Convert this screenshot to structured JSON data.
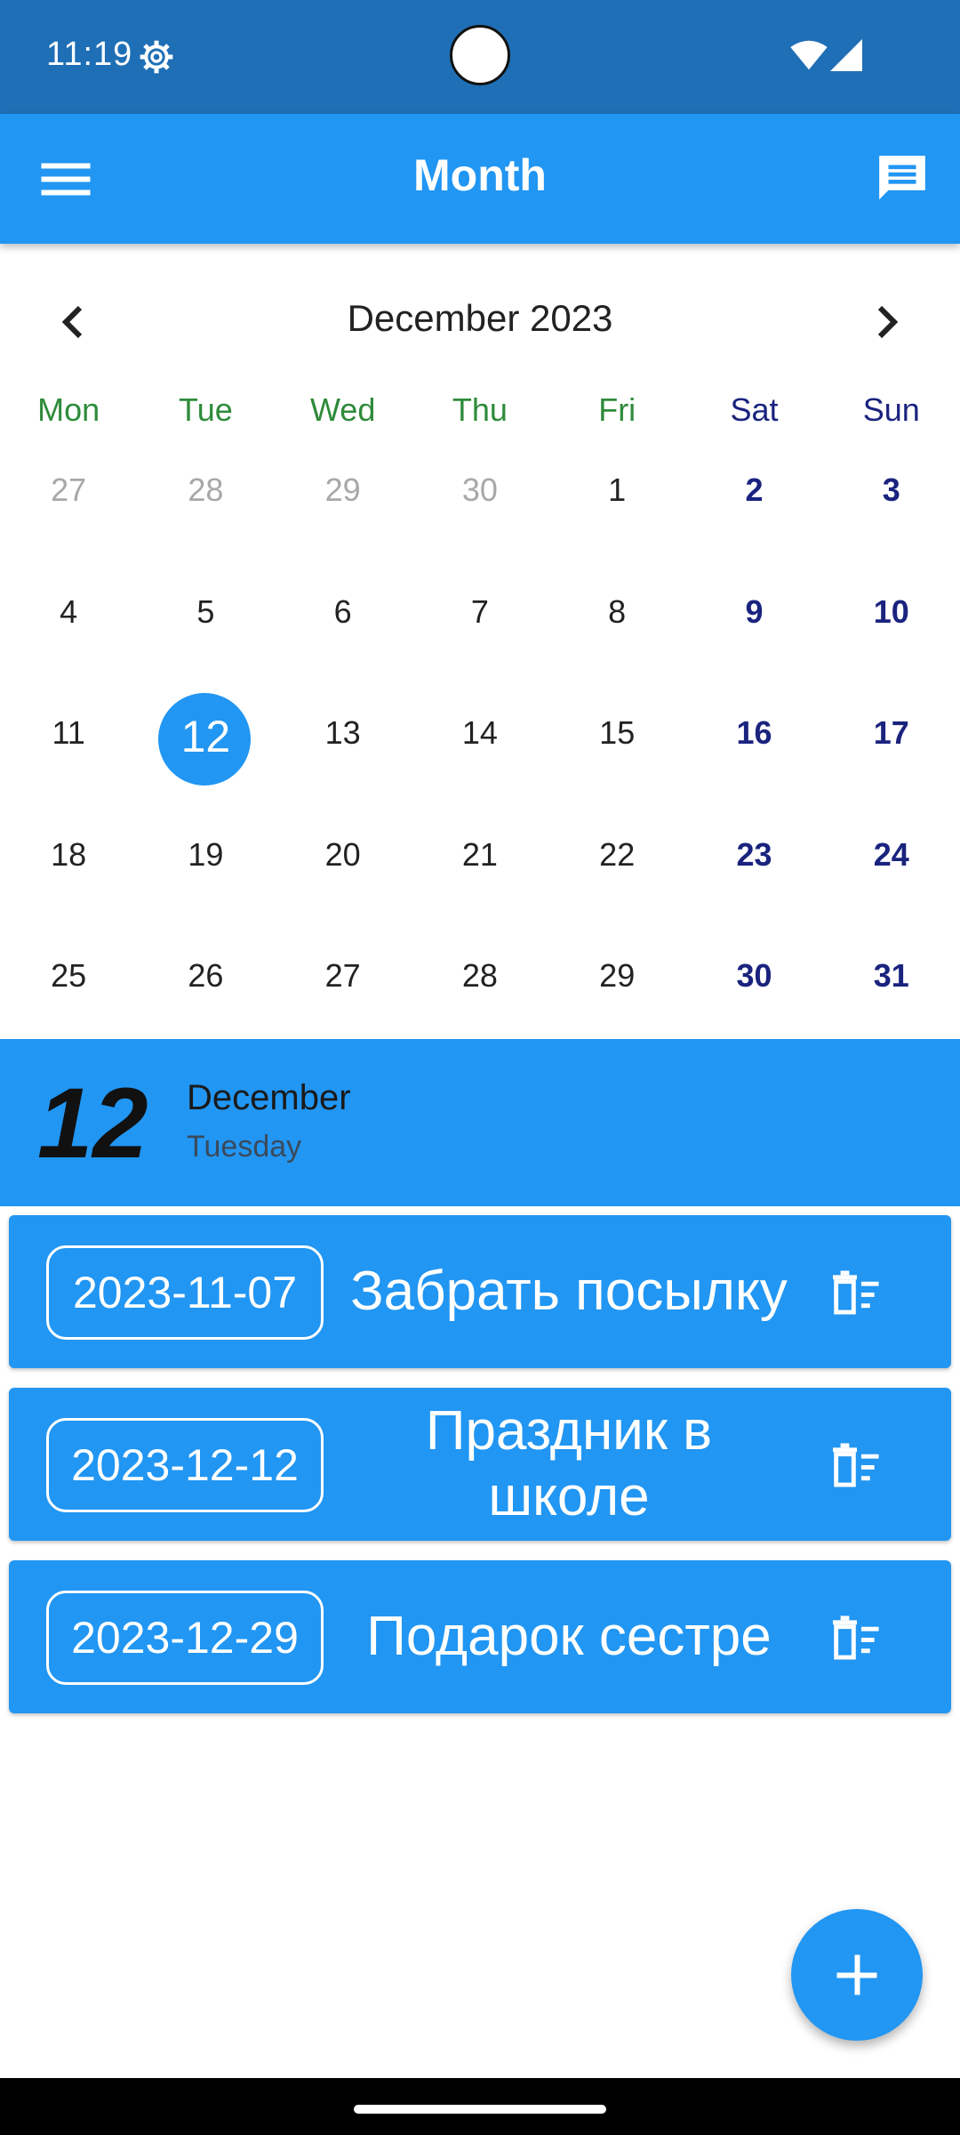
{
  "status_bar": {
    "time": "11:19"
  },
  "app_bar": {
    "title": "Month"
  },
  "calendar": {
    "month_label": "December 2023",
    "weekdays": [
      "Mon",
      "Tue",
      "Wed",
      "Thu",
      "Fri",
      "Sat",
      "Sun"
    ],
    "weeks": [
      [
        "27",
        "28",
        "29",
        "30",
        "1",
        "2",
        "3"
      ],
      [
        "4",
        "5",
        "6",
        "7",
        "8",
        "9",
        "10"
      ],
      [
        "11",
        "12",
        "13",
        "14",
        "15",
        "16",
        "17"
      ],
      [
        "18",
        "19",
        "20",
        "21",
        "22",
        "23",
        "24"
      ],
      [
        "25",
        "26",
        "27",
        "28",
        "29",
        "30",
        "31"
      ]
    ],
    "selected_day": "12"
  },
  "selected_banner": {
    "day": "12",
    "month": "December",
    "weekday": "Tuesday"
  },
  "tasks": [
    {
      "date": "2023-11-07",
      "title": "Забрать посылку"
    },
    {
      "date": "2023-12-12",
      "title": "Праздник в школе"
    },
    {
      "date": "2023-12-29",
      "title": "Подарок сестре"
    }
  ],
  "colors": {
    "primary": "#2196f3",
    "status_bar": "#1f6fb6",
    "weekday_green": "#2e8b3a",
    "weekend_navy": "#1a237e"
  },
  "icons": {
    "menu": "menu-icon",
    "chat": "chat-icon",
    "prev": "chevron-left-icon",
    "next": "chevron-right-icon",
    "delete": "delete-sweep-icon",
    "add": "plus-icon"
  }
}
